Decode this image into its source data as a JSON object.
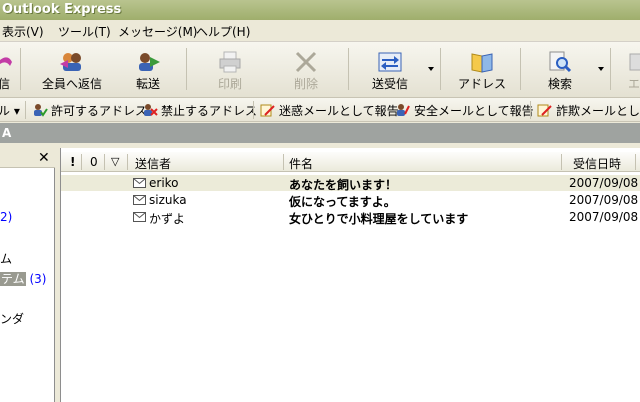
{
  "window": {
    "title": "Outlook Express"
  },
  "menu": [
    {
      "label": "表示(V)"
    },
    {
      "label": "ツール(T)"
    },
    {
      "label": "メッセージ(M)"
    },
    {
      "label": "ヘルプ(H)"
    }
  ],
  "toolbar": {
    "reply_label": "信",
    "reply_all_label": "全員へ返信",
    "forward_label": "転送",
    "print_label": "印刷",
    "delete_label": "削除",
    "send_receive_label": "送受信",
    "addresses_label": "アドレス",
    "find_label": "検索",
    "encoding_label": "エ"
  },
  "toolbar2": {
    "rules_label": "ル",
    "allow_label": "許可するアドレス",
    "block_label": "禁止するアドレス",
    "report_spam_label": "迷惑メールとして報告",
    "report_safe_label": "安全メールとして報告",
    "report_fraud_label": "詐欺メールとして報"
  },
  "path": {
    "label": "A"
  },
  "folders": [
    {
      "label": "2)"
    },
    {
      "label": "ム"
    },
    {
      "label": "テム",
      "count": "(3)"
    },
    {
      "label": "ンダ"
    }
  ],
  "columns": {
    "priority": "!",
    "attachment": "0",
    "flag": "▽",
    "from": "送信者",
    "subject": "件名",
    "received": "受信日時"
  },
  "messages": [
    {
      "from": "eriko",
      "subject": "あなたを飼います！",
      "date": "2007/09/08"
    },
    {
      "from": "sizuka",
      "subject": "仮になってますよ。",
      "date": "2007/09/08"
    },
    {
      "from": "かずよ",
      "subject": "女ひとりで小料理屋をしています",
      "date": "2007/09/08"
    }
  ]
}
